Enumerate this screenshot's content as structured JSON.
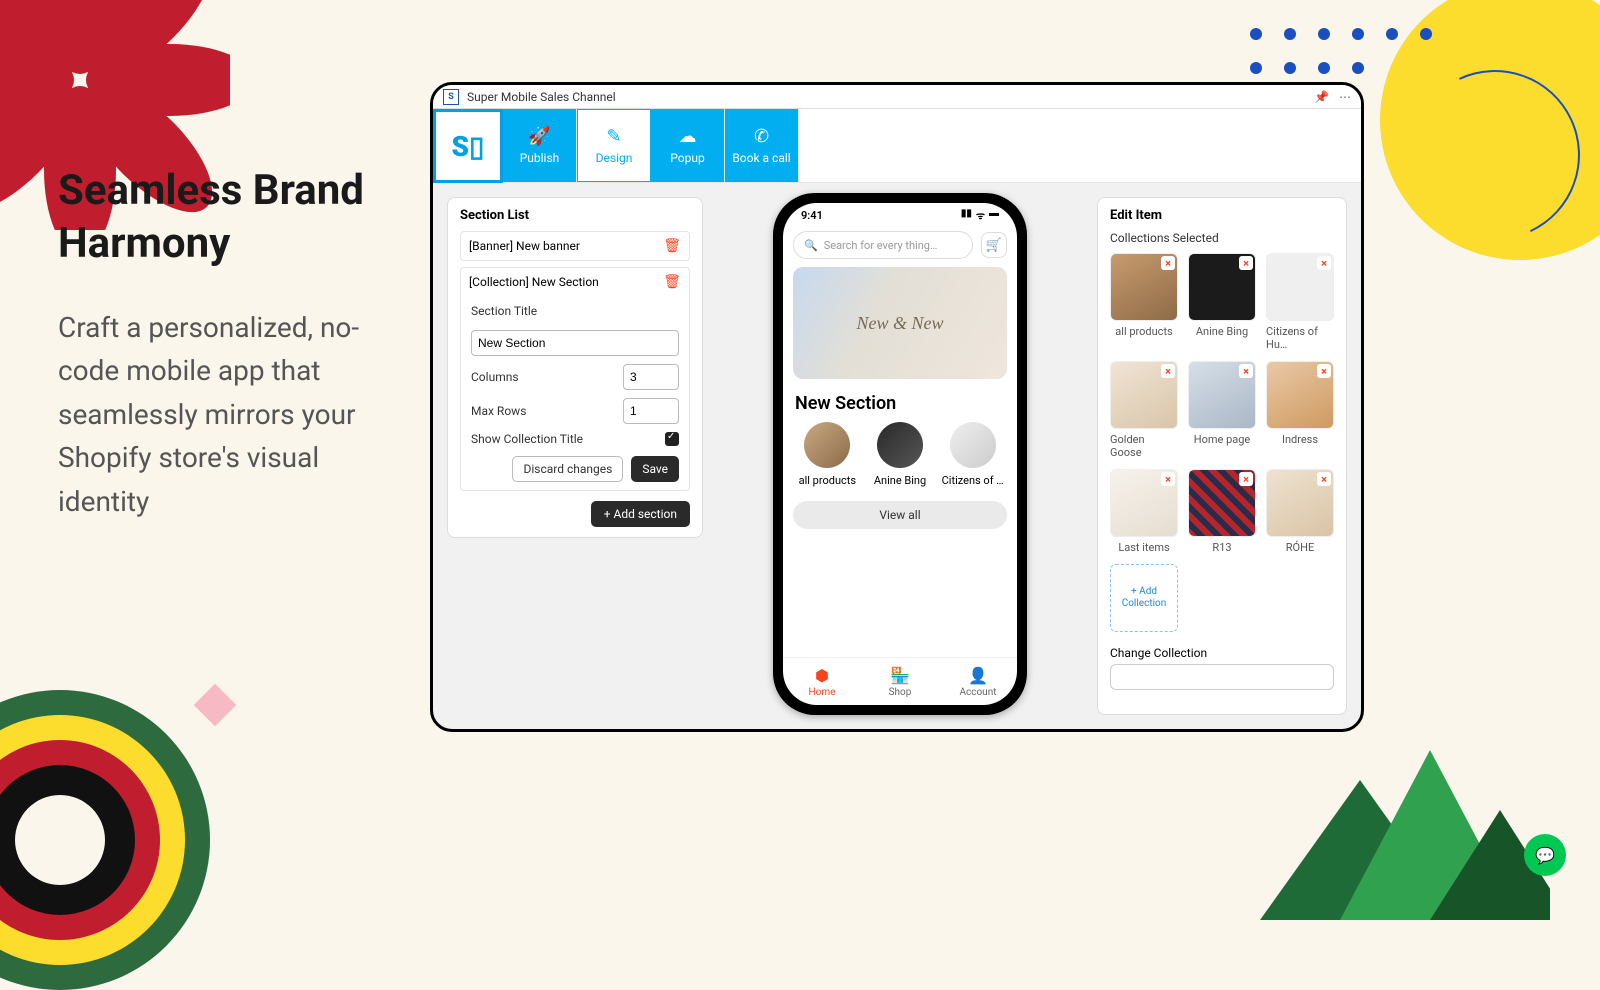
{
  "copy": {
    "heading": "Seamless Brand Harmony",
    "body": "Craft a personalized, no-code mobile app that seamlessly mirrors your Shopify store's visual identity"
  },
  "window": {
    "title": "Super Mobile Sales Channel",
    "nav": {
      "publish": "Publish",
      "design": "Design",
      "popup": "Popup",
      "book": "Book a call"
    }
  },
  "left": {
    "title": "Section List",
    "row_banner": "[Banner] New banner",
    "row_collection": "[Collection] New Section",
    "label_section_title": "Section Title",
    "value_section_title": "New Section",
    "label_columns": "Columns",
    "value_columns": "3",
    "label_maxrows": "Max Rows",
    "value_maxrows": "1",
    "label_showtitle": "Show Collection Title",
    "btn_discard": "Discard changes",
    "btn_save": "Save",
    "btn_add": "+  Add section"
  },
  "phone": {
    "time": "9:41",
    "search_placeholder": "Search for every thing…",
    "banner_text": "New & New",
    "section_title": "New Section",
    "c1": "all products",
    "c2": "Anine Bing",
    "c3": "Citizens of …",
    "viewall": "View all",
    "tab_home": "Home",
    "tab_shop": "Shop",
    "tab_account": "Account"
  },
  "right": {
    "title": "Edit Item",
    "sub": "Collections Selected",
    "items": {
      "i1": "all products",
      "i2": "Anine Bing",
      "i3": "Citizens of Hu…",
      "i4": "Golden Goose",
      "i5": "Home page",
      "i6": "Indress",
      "i7": "Last items",
      "i8": "R13",
      "i9": "RÓHE"
    },
    "add": "+ Add Collection",
    "change_label": "Change Collection"
  }
}
